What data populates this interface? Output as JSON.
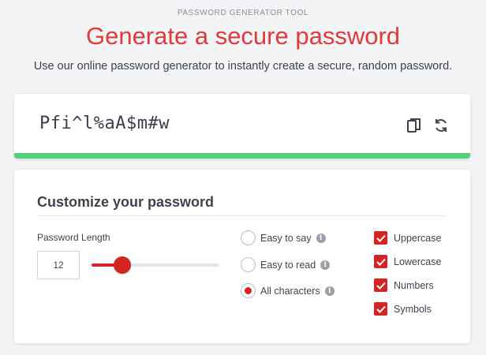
{
  "header": {
    "eyebrow": "PASSWORD GENERATOR TOOL",
    "title": "Generate a secure password",
    "subtitle": "Use our online password generator to instantly create a secure, random password."
  },
  "password": {
    "value": "Pfi^l%aA$m#w",
    "copy_icon": "copy-icon",
    "refresh_icon": "refresh-icon",
    "strength_fraction": 1.0,
    "strength_color": "#4fd27a"
  },
  "customize": {
    "title": "Customize your password",
    "length_label": "Password Length",
    "length_value": "12",
    "slider_fraction": 0.24,
    "radio_options": [
      {
        "label": "Easy to say",
        "checked": false
      },
      {
        "label": "Easy to read",
        "checked": false
      },
      {
        "label": "All characters",
        "checked": true
      }
    ],
    "checkboxes": [
      {
        "label": "Uppercase",
        "checked": true
      },
      {
        "label": "Lowercase",
        "checked": true
      },
      {
        "label": "Numbers",
        "checked": true
      },
      {
        "label": "Symbols",
        "checked": true
      }
    ]
  },
  "colors": {
    "accent": "#e03a3a",
    "control": "#d62424",
    "strength": "#4fd27a"
  }
}
